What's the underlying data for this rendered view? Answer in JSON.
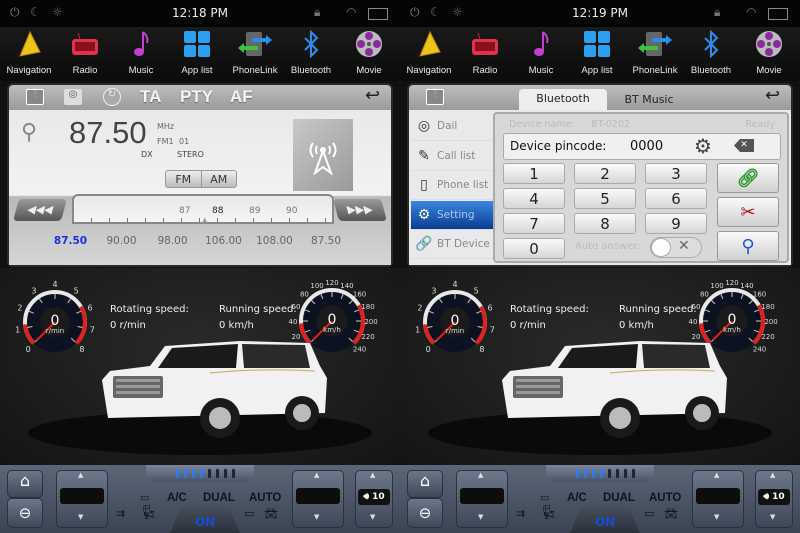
{
  "panels": [
    {
      "time": "12:18 PM",
      "screen": "radio"
    },
    {
      "time": "12:19 PM",
      "screen": "bluetooth"
    }
  ],
  "dock": [
    {
      "label": "Navigation",
      "icon": "navigation-icon"
    },
    {
      "label": "Radio",
      "icon": "radio-icon"
    },
    {
      "label": "Music",
      "icon": "music-note-icon"
    },
    {
      "label": "App list",
      "icon": "app-grid-icon"
    },
    {
      "label": "PhoneLink",
      "icon": "phonelink-icon"
    },
    {
      "label": "Bluetooth",
      "icon": "bluetooth-icon"
    },
    {
      "label": "Movie",
      "icon": "film-reel-icon"
    }
  ],
  "radio": {
    "toolbar": {
      "ta": "TA",
      "pty": "PTY",
      "af": "AF"
    },
    "frequency": "87.50",
    "unit": "MHz",
    "band": "FM1",
    "preset_no": "01",
    "dx": "DX",
    "stereo": "STERO",
    "fm": "FM",
    "am": "AM",
    "scale": [
      "87",
      "88",
      "89",
      "90"
    ],
    "scale_current": "88",
    "presets": [
      "87.50",
      "90.00",
      "98.00",
      "106.00",
      "108.00",
      "87.50"
    ],
    "active_preset": 0
  },
  "bluetooth": {
    "tabs": [
      "Bluetooth",
      "BT Music"
    ],
    "active_tab": 0,
    "side": [
      {
        "label": "Dail",
        "icon": "dial-icon"
      },
      {
        "label": "Call list",
        "icon": "call-list-icon"
      },
      {
        "label": "Phone list",
        "icon": "phonebook-icon"
      },
      {
        "label": "Setting",
        "icon": "gear-icon"
      },
      {
        "label": "BT Device",
        "icon": "link-icon"
      }
    ],
    "active_side": 3,
    "device_name_label": "Device name:",
    "device_name": "BT-0202",
    "status": "Ready",
    "pincode_label": "Device pincode:",
    "pincode": "0000",
    "keys": [
      "1",
      "2",
      "3",
      "4",
      "5",
      "6",
      "7",
      "8",
      "9",
      "0"
    ],
    "auto_answer_label": "Auto answer:",
    "auto_answer": false
  },
  "dashboard": {
    "rpm": {
      "value": "0",
      "unit": "r/min",
      "ticks": [
        "0",
        "1",
        "2",
        "3",
        "4",
        "5",
        "6",
        "7",
        "8"
      ]
    },
    "speed": {
      "value": "0",
      "unit": "km/h",
      "ticks": [
        "0",
        "20",
        "40",
        "60",
        "80",
        "100",
        "120",
        "140",
        "160",
        "180",
        "200",
        "220",
        "240"
      ]
    },
    "rotating_label": "Rotating speed:",
    "rotating_value": "0 r/min",
    "running_label": "Running speed:",
    "running_value": "0 km/h"
  },
  "climate": {
    "ac": "A/C",
    "dual": "DUAL",
    "auto": "AUTO",
    "on": "ON",
    "volume": "10",
    "fan_level": 4,
    "fan_max": 8
  },
  "colors": {
    "accent_blue": "#1a66c8",
    "gauge_red": "#e0201c",
    "preset_active": "#1a2fe0"
  }
}
